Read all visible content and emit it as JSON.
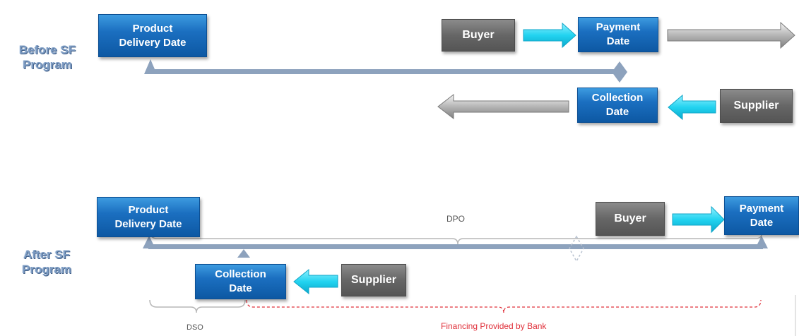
{
  "before": {
    "label_line1": "Before SF",
    "label_line2": "Program",
    "delivery": {
      "line1": "Product",
      "line2": "Delivery Date"
    },
    "buyer": "Buyer",
    "payment": {
      "line1": "Payment",
      "line2": "Date"
    },
    "collection": {
      "line1": "Collection",
      "line2": "Date"
    },
    "supplier": "Supplier"
  },
  "after": {
    "label_line1": "After SF",
    "label_line2": "Program",
    "delivery": {
      "line1": "Product",
      "line2": "Delivery Date"
    },
    "buyer": "Buyer",
    "payment": {
      "line1": "Payment",
      "line2": "Date"
    },
    "collection": {
      "line1": "Collection",
      "line2": "Date"
    },
    "supplier": "Supplier",
    "dpo": "DPO",
    "dso": "DSO",
    "financing": "Financing Provided by Bank"
  },
  "colors": {
    "box_blue": "#1b6fc0",
    "box_gray": "#666666",
    "cyan_arrow": "#22d3f0",
    "timeline": "#8da2bd",
    "financing_red": "#e0303a"
  }
}
